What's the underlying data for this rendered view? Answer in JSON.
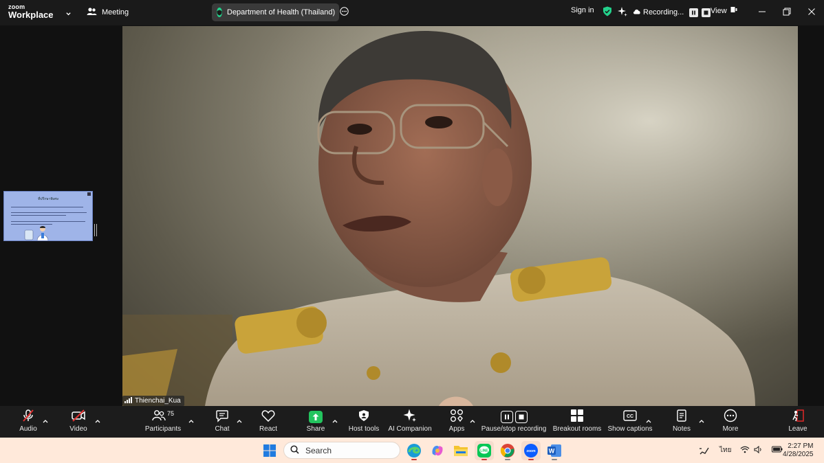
{
  "topbar": {
    "logo_line1": "zoom",
    "logo_line2": "Workplace",
    "meeting_label": "Meeting",
    "meeting_title": "Department of Health (Thailand)",
    "sign_in": "Sign in",
    "recording_label": "Recording...",
    "view_label": "View"
  },
  "thumbnail": {
    "slide_title": "ที่ปรึกษาพิเศษ"
  },
  "video": {
    "participant_name": "Thienchai_Kua"
  },
  "toolbar": {
    "audio": "Audio",
    "video": "Video",
    "participants": "Participants",
    "participants_count": "75",
    "chat": "Chat",
    "react": "React",
    "share": "Share",
    "host_tools": "Host tools",
    "ai_companion": "AI Companion",
    "apps": "Apps",
    "pause_stop_recording": "Pause/stop recording",
    "breakout_rooms": "Breakout rooms",
    "show_captions": "Show captions",
    "notes": "Notes",
    "more": "More",
    "leave": "Leave"
  },
  "taskbar": {
    "search_placeholder": "Search",
    "language": "ไทย",
    "time": "2:27 PM",
    "date": "4/28/2025"
  },
  "colors": {
    "share_green": "#23c45e",
    "leave_red": "#e02828",
    "shield_green": "#23d18b"
  }
}
